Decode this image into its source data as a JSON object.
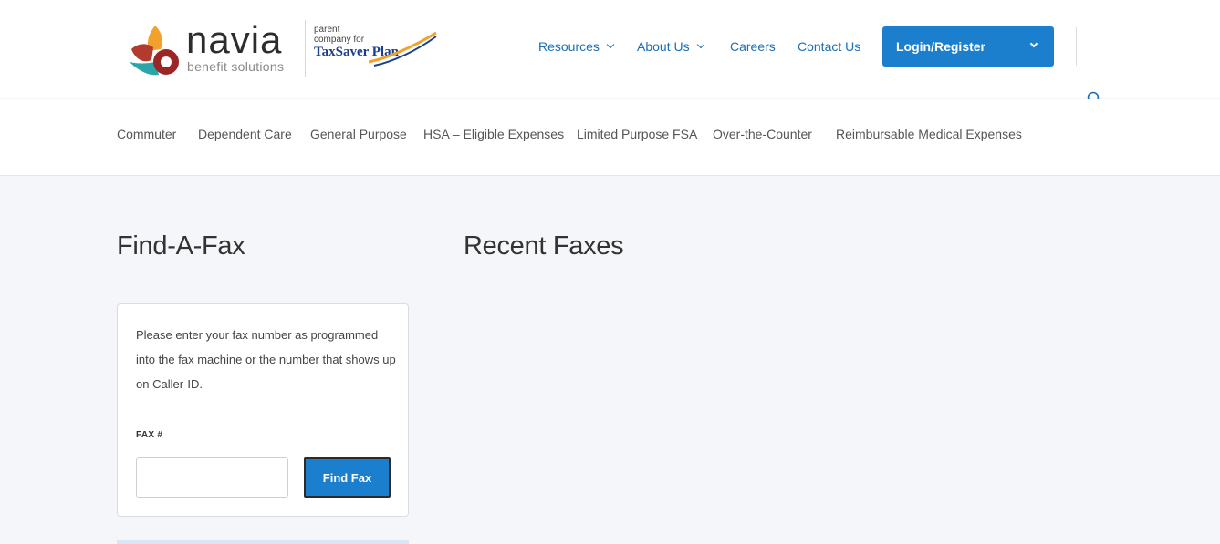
{
  "brand": {
    "name": "navia",
    "tagline": "benefit solutions",
    "parent_text": "parent company for",
    "partner_name": "TaxSaver Plan",
    "colors": {
      "accent": "#1c7fcd",
      "link": "#1a6fb5",
      "logo_red": "#a52a2a",
      "logo_teal": "#2aa6a8",
      "logo_orange": "#f2a12a"
    }
  },
  "nav": {
    "resources": "Resources",
    "about": "About Us",
    "careers": "Careers",
    "contact": "Contact Us",
    "login": "Login/Register"
  },
  "subnav": {
    "items": [
      "Commuter",
      "Dependent Care",
      "General Purpose",
      "HSA – Eligible Expenses",
      "Limited Purpose FSA",
      "Over-the-Counter",
      "Reimbursable Medical Expenses"
    ]
  },
  "main": {
    "find_title": "Find-A-Fax",
    "recent_title": "Recent Faxes",
    "instructions": "Please enter your fax number as programmed into the fax machine or the number that shows up on Caller-ID.",
    "fax_label": "FAX #",
    "fax_value": "",
    "find_button": "Find Fax"
  }
}
